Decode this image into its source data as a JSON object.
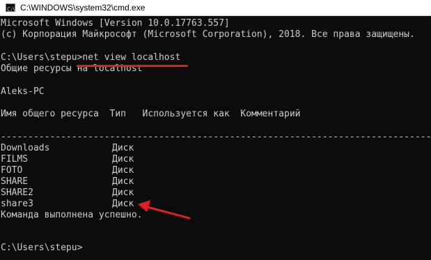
{
  "window": {
    "title": "C:\\WINDOWS\\system32\\cmd.exe",
    "icon": "cmd-icon"
  },
  "console": {
    "header": [
      "Microsoft Windows [Version 10.0.17763.557]",
      "(c) Корпорация Майкрософт (Microsoft Corporation), 2018. Все права защищены."
    ],
    "prompt1": {
      "path": "C:\\Users\\stepu>",
      "command": "net view localhost"
    },
    "resources_title": "Общие ресурсы на localhost",
    "host": "Aleks-PC",
    "columns_header": "Имя общего ресурса  Тип   Используется как  Комментарий",
    "separator": "--------------------------------------------------------------------------------",
    "shares": [
      {
        "name": "Downloads",
        "type": "Диск"
      },
      {
        "name": "FILMS",
        "type": "Диск"
      },
      {
        "name": "FOTO",
        "type": "Диск"
      },
      {
        "name": "SHARE",
        "type": "Диск"
      },
      {
        "name": "SHARE2",
        "type": "Диск"
      },
      {
        "name": "share3",
        "type": "Диск"
      }
    ],
    "status": "Команда выполнена успешно.",
    "prompt2": "C:\\Users\\stepu>"
  },
  "colors": {
    "console_bg": "#0c0c0c",
    "console_fg": "#cccccc",
    "annotation": "#e11e24",
    "titlebar_bg": "#ffffff"
  }
}
